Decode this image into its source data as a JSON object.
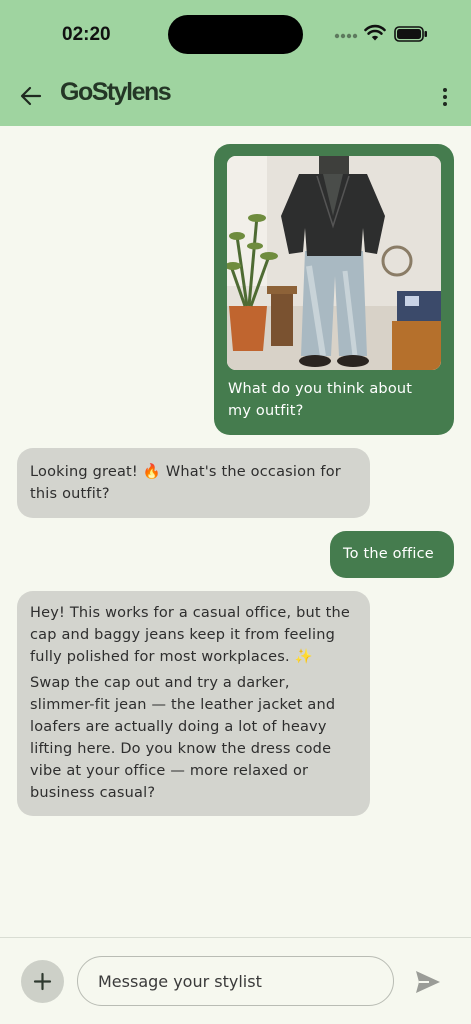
{
  "status_bar": {
    "time": "02:20",
    "icons": [
      "signal-dots-icon",
      "wifi-icon",
      "battery-icon"
    ]
  },
  "header": {
    "app_name": "GoStylens",
    "back_icon": "arrow-left-icon",
    "menu_icon": "more-vertical-icon"
  },
  "colors": {
    "header_bg": "#9fd4a0",
    "outgoing_bubble": "#457c4e",
    "incoming_bubble": "#d3d4ce",
    "page_bg": "#f6f8ef"
  },
  "messages": [
    {
      "sender": "user",
      "has_image": true,
      "text": "What do you think about my outfit?"
    },
    {
      "sender": "stylist",
      "text": "Looking great! 🔥  What's the occasion for this outfit?"
    },
    {
      "sender": "user",
      "text": "To the office"
    },
    {
      "sender": "stylist",
      "paragraphs": [
        "Hey! This works for a casual office, but the cap and baggy jeans keep it from feeling fully polished for most workplaces. ✨",
        "Swap the cap out and try a darker, slimmer-fit jean — the leather jacket and loafers are actually doing a lot of heavy lifting here. Do you know the dress code vibe at your office — more relaxed or business casual?"
      ]
    }
  ],
  "composer": {
    "placeholder": "Message your stylist",
    "value": "",
    "attach_icon": "plus-icon",
    "send_icon": "send-icon"
  }
}
